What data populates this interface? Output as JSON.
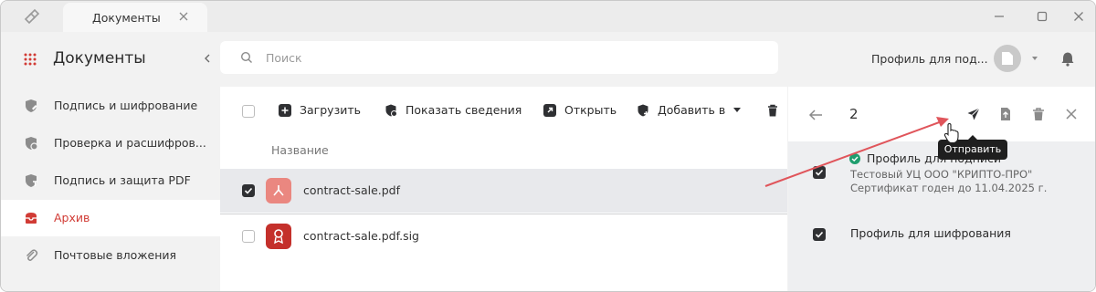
{
  "window": {
    "tab_title": "Документы"
  },
  "sidebar": {
    "title": "Документы",
    "items": [
      {
        "label": "Подпись и шифрование",
        "icon": "shield-pen-icon",
        "active": false
      },
      {
        "label": "Проверка и расшифров...",
        "icon": "shield-check-icon",
        "active": false
      },
      {
        "label": "Подпись и защита PDF",
        "icon": "shield-pdf-icon",
        "active": false
      },
      {
        "label": "Архив",
        "icon": "archive-icon",
        "active": true
      },
      {
        "label": "Почтовые вложения",
        "icon": "paperclip-icon",
        "active": false
      }
    ]
  },
  "search": {
    "placeholder": "Поиск"
  },
  "header": {
    "profile_label": "Профиль для под..."
  },
  "toolbar": {
    "upload_label": "Загрузить",
    "show_info_label": "Показать сведения",
    "open_label": "Открыть",
    "add_to_label": "Добавить в"
  },
  "table": {
    "column_name": "Название",
    "rows": [
      {
        "name": "contract-sale.pdf",
        "checked": true,
        "icon": "pdf-file-icon"
      },
      {
        "name": "contract-sale.pdf.sig",
        "checked": false,
        "icon": "signature-file-icon"
      }
    ]
  },
  "details": {
    "count": "2",
    "tooltip": "Отправить",
    "profiles": [
      {
        "title": "Профиль для подписи",
        "line1": "Тестовый УЦ ООО \"КРИПТО-ПРО\"",
        "line2": "Сертификат годен до 11.04.2025 г."
      },
      {
        "title": "Профиль для шифрования"
      }
    ]
  },
  "colors": {
    "accent": "#d13b35",
    "annotation_arrow": "#e0555b",
    "check_badge": "#1f9e6e"
  }
}
